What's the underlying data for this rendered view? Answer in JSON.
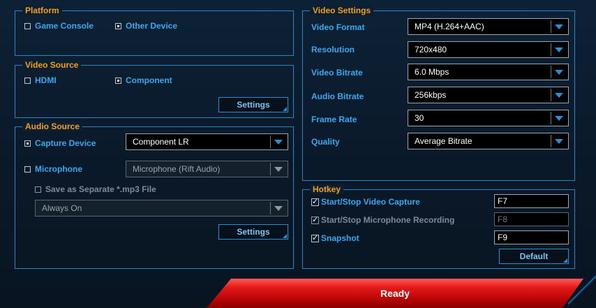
{
  "platform": {
    "title": "Platform",
    "options": [
      {
        "label": "Game Console",
        "selected": false
      },
      {
        "label": "Other Device",
        "selected": true
      }
    ]
  },
  "video_source": {
    "title": "Video Source",
    "options": [
      {
        "label": "HDMI",
        "selected": false
      },
      {
        "label": "Component",
        "selected": true
      }
    ],
    "settings_label": "Settings"
  },
  "audio_source": {
    "title": "Audio Source",
    "capture_device": {
      "label": "Capture Device",
      "checked": true,
      "value": "Component LR"
    },
    "microphone": {
      "label": "Microphone",
      "checked": false,
      "value": "Microphone (Rift Audio)"
    },
    "save_separate": {
      "label": "Save as Separate *.mp3 File",
      "checked": false
    },
    "mode_value": "Always On",
    "settings_label": "Settings"
  },
  "video_settings": {
    "title": "Video Settings",
    "rows": [
      {
        "label": "Video Format",
        "value": "MP4 (H.264+AAC)"
      },
      {
        "label": "Resolution",
        "value": "720x480"
      },
      {
        "label": "Video Bitrate",
        "value": "6.0 Mbps"
      },
      {
        "label": "Audio Bitrate",
        "value": "256kbps"
      },
      {
        "label": "Frame Rate",
        "value": "30"
      },
      {
        "label": "Quality",
        "value": "Average Bitrate"
      }
    ]
  },
  "hotkey": {
    "title": "Hotkey",
    "items": [
      {
        "label": "Start/Stop Video Capture",
        "checked": true,
        "key": "F7"
      },
      {
        "label": "Start/Stop Microphone Recording",
        "checked": false,
        "key": "F8"
      },
      {
        "label": "Snapshot",
        "checked": true,
        "key": "F9"
      }
    ],
    "default_label": "Default"
  },
  "ready_label": "Ready",
  "colors": {
    "accent": "#3aa8ef",
    "title": "#f2a01e",
    "border": "#2a87c4",
    "ready": "#e41a1a"
  }
}
